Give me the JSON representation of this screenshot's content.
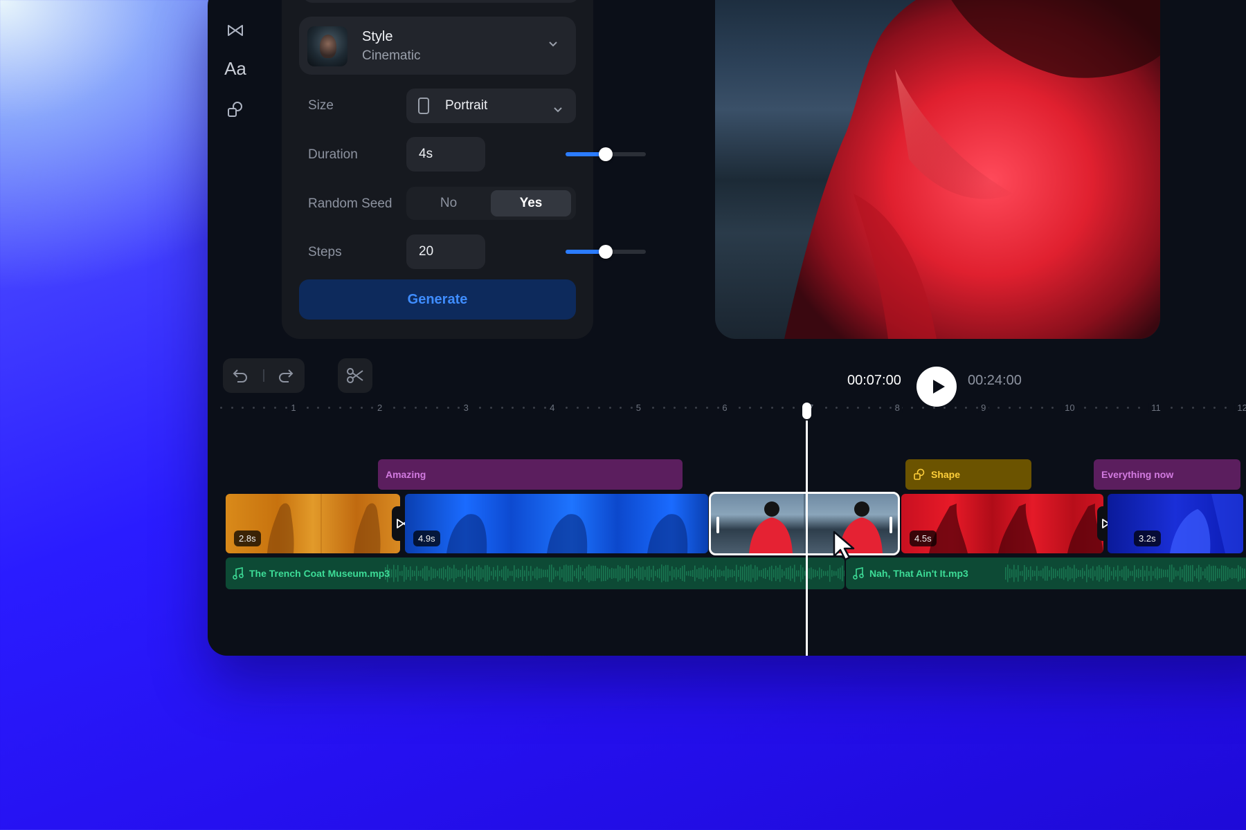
{
  "style_card": {
    "title": "Style",
    "value": "Cinematic"
  },
  "size": {
    "label": "Size",
    "value": "Portrait"
  },
  "duration": {
    "label": "Duration",
    "value": "4s",
    "slider_fraction": 0.5
  },
  "random_seed": {
    "label": "Random Seed",
    "options": [
      "No",
      "Yes"
    ],
    "selected": "Yes"
  },
  "steps": {
    "label": "Steps",
    "value": "20",
    "slider_fraction": 0.5
  },
  "generate_label": "Generate",
  "playback": {
    "current_time": "00:07:00",
    "total_time": "00:24:00"
  },
  "ruler_labels": [
    "1",
    "2",
    "3",
    "4",
    "5",
    "6",
    "7",
    "8",
    "9",
    "10",
    "11",
    "12"
  ],
  "text_track": [
    {
      "label": "Amazing",
      "color": "#5b1e5e",
      "text_color": "#d27be0"
    },
    {
      "label": "Shape",
      "color": "#6b5300",
      "text_color": "#ffcf3a",
      "icon": "shape-icon"
    },
    {
      "label": "Everything now",
      "color": "#5b1e5e",
      "text_color": "#d27be0"
    }
  ],
  "video_track": [
    {
      "duration": "2.8s",
      "theme": "amber"
    },
    {
      "duration": "4.9s",
      "theme": "blue"
    },
    {
      "duration": "",
      "theme": "coast",
      "selected": true
    },
    {
      "duration": "4.5s",
      "theme": "red"
    },
    {
      "duration": "3.2s",
      "theme": "deepblue"
    }
  ],
  "audio_track": [
    {
      "label": "The Trench Coat Museum.mp3"
    },
    {
      "label": "Nah, That Ain't It.mp3"
    }
  ],
  "colors": {
    "accent": "#2b7cff",
    "generate_bg": "#0d2a5c",
    "audio_bg": "#0d4a35",
    "audio_text": "#3ddc97"
  },
  "icons": [
    "transition-icon",
    "text-icon",
    "shapes-icon",
    "chevron-down-icon",
    "portrait-icon",
    "undo-icon",
    "redo-icon",
    "scissors-icon",
    "play-icon",
    "music-note-icon",
    "cursor-icon"
  ]
}
